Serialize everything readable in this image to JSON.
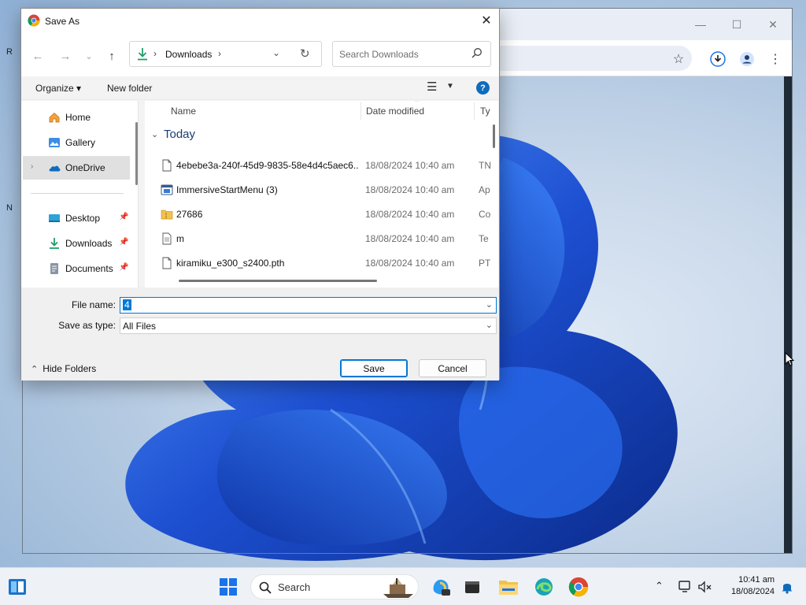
{
  "dialog": {
    "title": "Save As",
    "close_glyph": "✕",
    "nav": {
      "back_glyph": "←",
      "forward_glyph": "→",
      "recent_glyph": "⌄",
      "up_glyph": "↑"
    },
    "address": {
      "sep1": "›",
      "crumb": "Downloads",
      "sep2": "›",
      "dropdown_glyph": "⌄",
      "refresh_glyph": "↻"
    },
    "search": {
      "placeholder": "Search Downloads"
    },
    "commands": {
      "organize": "Organize ▾",
      "new_folder": "New folder",
      "view_glyph": "☰",
      "view_dd_glyph": "▼",
      "help_glyph": "?"
    },
    "nav_pane": {
      "items": [
        {
          "label": "Home",
          "icon": "home-icon"
        },
        {
          "label": "Gallery",
          "icon": "gallery-icon"
        },
        {
          "label": "OneDrive",
          "icon": "onedrive-icon",
          "expander": "›",
          "selected": true
        },
        {
          "label": "Desktop",
          "icon": "desktop-icon",
          "pin": "📌"
        },
        {
          "label": "Downloads",
          "icon": "downloads-icon",
          "pin": "📌"
        },
        {
          "label": "Documents",
          "icon": "documents-icon",
          "pin": "📌"
        }
      ]
    },
    "columns": {
      "name": "Name",
      "date": "Date modified",
      "type": "Ty",
      "sort_glyph": "⌃"
    },
    "group": {
      "chevron": "⌄",
      "title": "Today"
    },
    "files": [
      {
        "name": "4ebebe3a-240f-45d9-9835-58e4d4c5aec6....",
        "date": "18/08/2024 10:40 am",
        "type": "TN",
        "icon": "file-icon"
      },
      {
        "name": "ImmersiveStartMenu (3)",
        "date": "18/08/2024 10:40 am",
        "type": "Ap",
        "icon": "app-icon"
      },
      {
        "name": "27686",
        "date": "18/08/2024 10:40 am",
        "type": "Co",
        "icon": "zip-folder-icon"
      },
      {
        "name": "m",
        "date": "18/08/2024 10:40 am",
        "type": "Te",
        "icon": "text-file-icon"
      },
      {
        "name": "kiramiku_e300_s2400.pth",
        "date": "18/08/2024 10:40 am",
        "type": "PT",
        "icon": "file-icon"
      }
    ],
    "form": {
      "file_name_label": "File name:",
      "file_name_value": "4",
      "save_type_label": "Save as type:",
      "save_type_value": "All Files",
      "dropdown_glyph": "⌄",
      "hide_folders_arrow": "⌃",
      "hide_folders": "Hide Folders",
      "save": "Save",
      "cancel": "Cancel"
    }
  },
  "chrome": {
    "minimize_glyph": "—",
    "maximize_glyph": "☐",
    "close_glyph": "✕",
    "bookmark_glyph": "☆",
    "menu_glyph": "⋮"
  },
  "taskbar": {
    "search_label": "Search",
    "tray_chevron": "⌃",
    "time": "10:41 am",
    "date": "18/08/2024"
  },
  "colors": {
    "accent": "#0078d4",
    "group_title": "#1a3d73",
    "wallpaper_blue": "#1d4fd1"
  }
}
